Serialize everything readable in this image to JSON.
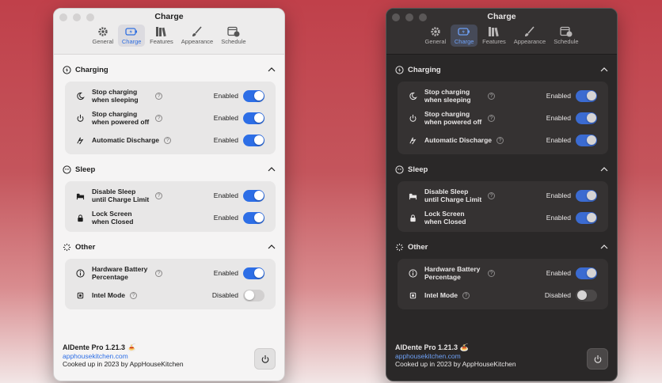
{
  "window": {
    "title": "Charge",
    "tabs": [
      {
        "label": "General",
        "icon": "gear-icon",
        "active": false
      },
      {
        "label": "Charge",
        "icon": "battery-icon",
        "active": true
      },
      {
        "label": "Features",
        "icon": "books-icon",
        "active": false
      },
      {
        "label": "Appearance",
        "icon": "paintbrush-icon",
        "active": false
      },
      {
        "label": "Schedule",
        "icon": "calendar-clock-icon",
        "active": false
      }
    ]
  },
  "sections": {
    "charging": {
      "title": "Charging",
      "rows": [
        {
          "label": "Stop charging when sleeping",
          "status": "Enabled",
          "on": true
        },
        {
          "label": "Stop charging when powered off",
          "status": "Enabled",
          "on": true
        },
        {
          "label": "Automatic Discharge",
          "status": "Enabled",
          "on": true
        }
      ]
    },
    "sleep": {
      "title": "Sleep",
      "rows": [
        {
          "label": "Disable Sleep until Charge Limit",
          "status": "Enabled",
          "on": true
        },
        {
          "label": "Lock Screen when Closed",
          "status": "Enabled",
          "on": true
        }
      ]
    },
    "other": {
      "title": "Other",
      "rows": [
        {
          "label": "Hardware Battery Percentage",
          "status": "Enabled",
          "on": true
        },
        {
          "label": "Intel Mode",
          "status": "Disabled",
          "on": false
        }
      ]
    }
  },
  "footer": {
    "app_name": "AlDente Pro 1.21.3 🍝",
    "link": "apphousekitchen.com",
    "credit": "Cooked up in 2023 by AppHouseKitchen"
  },
  "help_glyph": "?",
  "colors": {
    "accent": "#2d6ee6",
    "background_gradient_top": "#c0404a"
  }
}
